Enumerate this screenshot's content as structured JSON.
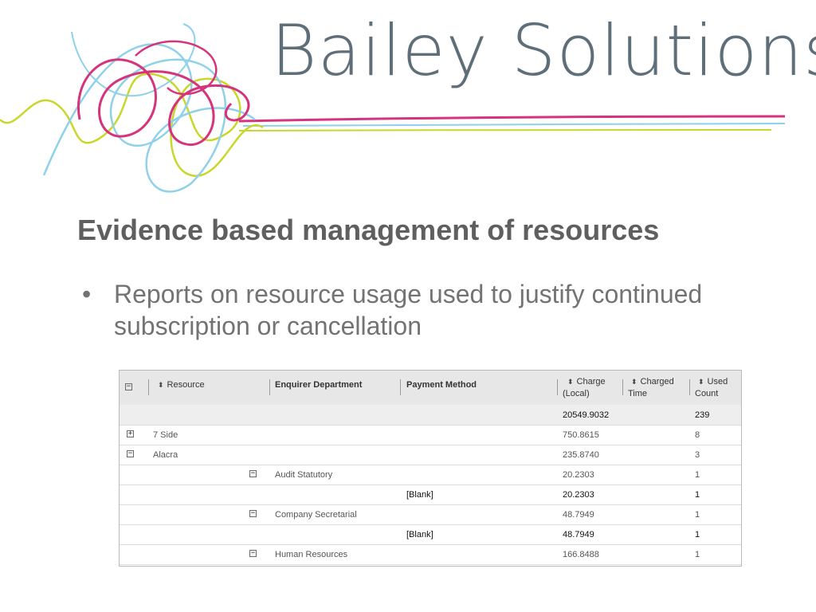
{
  "brand": {
    "name": "Bailey Solutions",
    "colors": {
      "pink": "#d6337d",
      "lime": "#c9d62a",
      "sky": "#8fd1e8",
      "text": "#5f6f7a"
    }
  },
  "slide": {
    "title": "Evidence based management of resources",
    "bullets": [
      {
        "marker": "•",
        "text": "Reports on resource usage used to justify continued subscription or cancellation"
      }
    ]
  },
  "report": {
    "columns": [
      {
        "label": "Resource",
        "sortable": true
      },
      {
        "label": "Enquirer Department",
        "sortable": false
      },
      {
        "label": "Payment Method",
        "sortable": false
      },
      {
        "label": "Charge (Local)",
        "line1": "Charge",
        "line2": "(Local)",
        "sortable": true
      },
      {
        "label": "Charged Time",
        "line1": "Charged",
        "line2": "Time",
        "sortable": true
      },
      {
        "label": "Used Count",
        "line1": "Used",
        "line2": "Count",
        "sortable": true
      }
    ],
    "header_toggle": "−",
    "sort_icon": "sort-arrows-icon",
    "rows": [
      {
        "level": "total",
        "resource": "",
        "department": "",
        "payment": "",
        "charge": "20549.9032",
        "time": "",
        "count": "239"
      },
      {
        "level": "resource",
        "toggle": "+",
        "expanded": false,
        "resource": "7 Side",
        "department": "",
        "payment": "",
        "charge": "750.8615",
        "time": "",
        "count": "8"
      },
      {
        "level": "resource",
        "toggle": "−",
        "expanded": true,
        "resource": "Alacra",
        "department": "",
        "payment": "",
        "charge": "235.8740",
        "time": "",
        "count": "3"
      },
      {
        "level": "department",
        "toggle": "−",
        "expanded": true,
        "resource": "",
        "department": "Audit Statutory",
        "payment": "",
        "charge": "20.2303",
        "time": "",
        "count": "1"
      },
      {
        "level": "payment",
        "resource": "",
        "department": "",
        "payment": "[Blank]",
        "charge": "20.2303",
        "time": "",
        "count": "1"
      },
      {
        "level": "department",
        "toggle": "−",
        "expanded": true,
        "resource": "",
        "department": "Company Secretarial",
        "payment": "",
        "charge": "48.7949",
        "time": "",
        "count": "1"
      },
      {
        "level": "payment",
        "resource": "",
        "department": "",
        "payment": "[Blank]",
        "charge": "48.7949",
        "time": "",
        "count": "1"
      },
      {
        "level": "department",
        "toggle": "−",
        "expanded": true,
        "resource": "",
        "department": "Human Resources",
        "payment": "",
        "charge": "166.8488",
        "time": "",
        "count": "1"
      }
    ]
  }
}
